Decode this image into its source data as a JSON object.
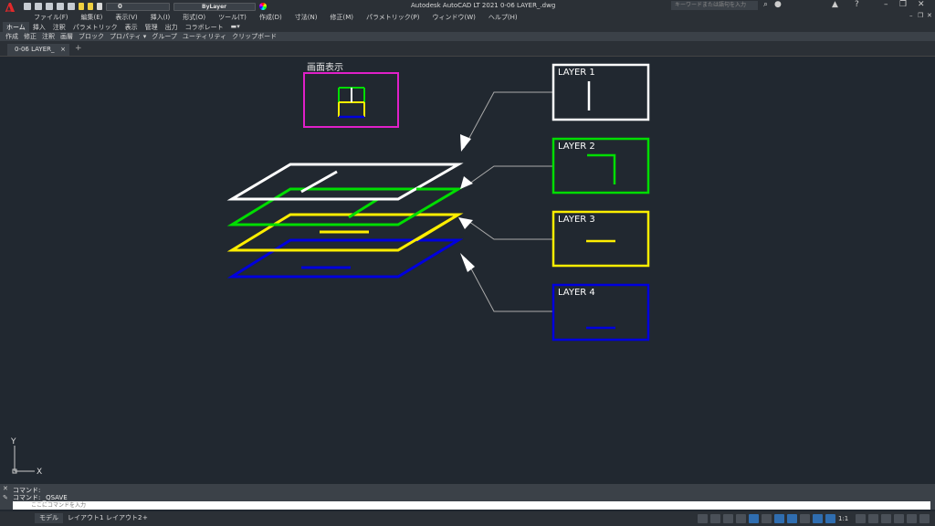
{
  "window": {
    "title": "Autodesk AutoCAD LT 2021    0-06 LAYER_.dwg",
    "search_placeholder": "キーワードまたは語句を入力"
  },
  "quick_access": {
    "layer_value": "0",
    "linetype_value": "ByLayer"
  },
  "menubar": [
    "ファイル(F)",
    "編集(E)",
    "表示(V)",
    "挿入(I)",
    "形式(O)",
    "ツール(T)",
    "作成(D)",
    "寸法(N)",
    "修正(M)",
    "パラメトリック(P)",
    "ウィンドウ(W)",
    "ヘルプ(H)"
  ],
  "ribbon_tabs": [
    "ホーム",
    "挿入",
    "注釈",
    "パラメトリック",
    "表示",
    "管理",
    "出力",
    "コラボレート"
  ],
  "ribbon_panels": [
    "作成",
    "修正",
    "注釈",
    "画層",
    "ブロック",
    "プロパティ ▾",
    "グループ",
    "ユーティリティ",
    "クリップボード"
  ],
  "file_tab": {
    "label": "0-06 LAYER_",
    "close": "×",
    "new": "+"
  },
  "drawing": {
    "preview_label": "画面表示",
    "layers": [
      {
        "name": "LAYER 1",
        "color": "#ffffff"
      },
      {
        "name": "LAYER 2",
        "color": "#00dd00"
      },
      {
        "name": "LAYER 3",
        "color": "#ffee00"
      },
      {
        "name": "LAYER 4",
        "color": "#0000dd"
      }
    ],
    "preview_frame_color": "#e020c8",
    "ucs_x": "X",
    "ucs_y": "Y"
  },
  "command": {
    "line1": "コマンド:",
    "line2": "コマンド:  _QSAVE",
    "placeholder": "ここにコマンドを入力"
  },
  "status": {
    "layout_tabs": [
      "モデル",
      "レイアウト1",
      "レイアウト2"
    ],
    "add_tab": "+",
    "scale": "1:1"
  }
}
